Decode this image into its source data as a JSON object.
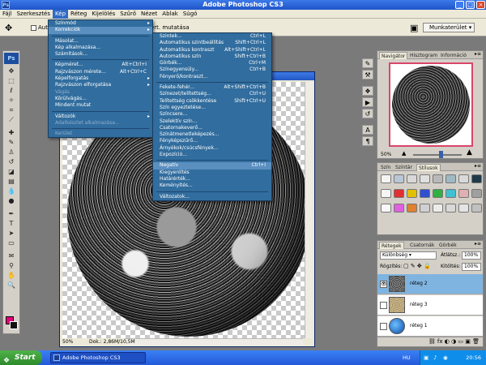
{
  "app": {
    "title": "Adobe Photoshop CS3",
    "logo": "Ps"
  },
  "menubar": [
    "Fájl",
    "Szerkesztés",
    "Kép",
    "Réteg",
    "Kijelölés",
    "Szűrő",
    "Nézet",
    "Ablak",
    "Súgó"
  ],
  "options": {
    "auto_label": "Auto",
    "transform_label": "ért. mutatása",
    "workspace_label": "Munkaterület"
  },
  "kep_menu": [
    {
      "label": "Színmód",
      "arrow": true
    },
    {
      "label": "Korrekciók",
      "arrow": true,
      "hl": true
    },
    {
      "sep": true
    },
    {
      "label": "Másolat..."
    },
    {
      "label": "Kép alkalmazása..."
    },
    {
      "label": "Számítások..."
    },
    {
      "sep": true
    },
    {
      "label": "Képméret...",
      "shortcut": "Alt+Ctrl+I"
    },
    {
      "label": "Rajzvászon mérete...",
      "shortcut": "Alt+Ctrl+C"
    },
    {
      "label": "Képelforgatás",
      "arrow": true
    },
    {
      "label": "Rajzvászon elforgatása",
      "arrow": true
    },
    {
      "label": "Vágás",
      "disabled": true
    },
    {
      "label": "Körülvágás..."
    },
    {
      "label": "Mindent mutat"
    },
    {
      "sep": true
    },
    {
      "label": "Változók",
      "arrow": true
    },
    {
      "label": "Adatkészlet alkalmazása...",
      "disabled": true
    },
    {
      "sep": true
    },
    {
      "label": "Kerület",
      "disabled": true
    }
  ],
  "korrekciok_menu": [
    {
      "label": "Szintek...",
      "shortcut": "Ctrl+L"
    },
    {
      "label": "Automatikus szintbeállítás",
      "shortcut": "Shift+Ctrl+L"
    },
    {
      "label": "Automatikus kontraszt",
      "shortcut": "Alt+Shift+Ctrl+L"
    },
    {
      "label": "Automatikus szín",
      "shortcut": "Shift+Ctrl+B"
    },
    {
      "label": "Görbék...",
      "shortcut": "Ctrl+M"
    },
    {
      "label": "Színegyensúly...",
      "shortcut": "Ctrl+B"
    },
    {
      "label": "Fényerő/kontraszt..."
    },
    {
      "sep": true
    },
    {
      "label": "Fekete-fehér...",
      "shortcut": "Alt+Shift+Ctrl+B"
    },
    {
      "label": "Színezet/telítettség...",
      "shortcut": "Ctrl+U"
    },
    {
      "label": "Telítettség csökkentése",
      "shortcut": "Shift+Ctrl+U"
    },
    {
      "label": "Szín egyeztetése..."
    },
    {
      "label": "Színcsere..."
    },
    {
      "label": "Szelektív szín..."
    },
    {
      "label": "Csatornakeverő..."
    },
    {
      "label": "Színátmenetleképezés..."
    },
    {
      "label": "Fényképszűrő..."
    },
    {
      "label": "Árnyékok/csúcsfények..."
    },
    {
      "label": "Expozíció..."
    },
    {
      "sep": true
    },
    {
      "label": "Negatív",
      "shortcut": "Ctrl+I",
      "hl": true
    },
    {
      "label": "Kiegyenlítés"
    },
    {
      "label": "Határérték..."
    },
    {
      "label": "Keményítés..."
    },
    {
      "sep": true
    },
    {
      "label": "Változatok..."
    }
  ],
  "document": {
    "zoom": "50%",
    "info": "Dok.: 2,86M/10,5M"
  },
  "navigator": {
    "tabs": [
      "Navigátor",
      "Hisztogram",
      "Információ"
    ],
    "zoom": "50%"
  },
  "swatches": {
    "tabs": [
      "Szín",
      "Színtár",
      "Stílusok"
    ],
    "colors": [
      "#f4f4f4",
      "#b8c7d6",
      "#d8d8d8",
      "#e0e0e0",
      "#b9b9b9",
      "#9fb9c4",
      "#d9d9d9",
      "#1e3a4a",
      "#f5f5f5",
      "#e03030",
      "#e0c000",
      "#3050d0",
      "#30b040",
      "#40c0d0",
      "#e0b0b0",
      "#a0a0a0",
      "#f8f8f8",
      "#e060e0",
      "#e08030",
      "#d0d0d0",
      "#ececec",
      "#d8d8d8",
      "#e4e4e4",
      "#c0c0c0"
    ]
  },
  "layers": {
    "tabs": [
      "Rétegek",
      "Csatornák",
      "Görbék"
    ],
    "blend_mode": "Különbség",
    "opacity_label": "Átlátsz.:",
    "opacity": "100%",
    "lock_label": "Rögzítés:",
    "fill_label": "Kitöltés:",
    "fill": "100%",
    "items": [
      {
        "name": "réteg 2",
        "selected": true
      },
      {
        "name": "réteg 3",
        "selected": false
      },
      {
        "name": "réteg 1",
        "selected": false
      }
    ]
  },
  "taskbar": {
    "start": "Start",
    "task": "Adobe Photoshop CS3",
    "lang": "HU",
    "time": "20:56"
  }
}
